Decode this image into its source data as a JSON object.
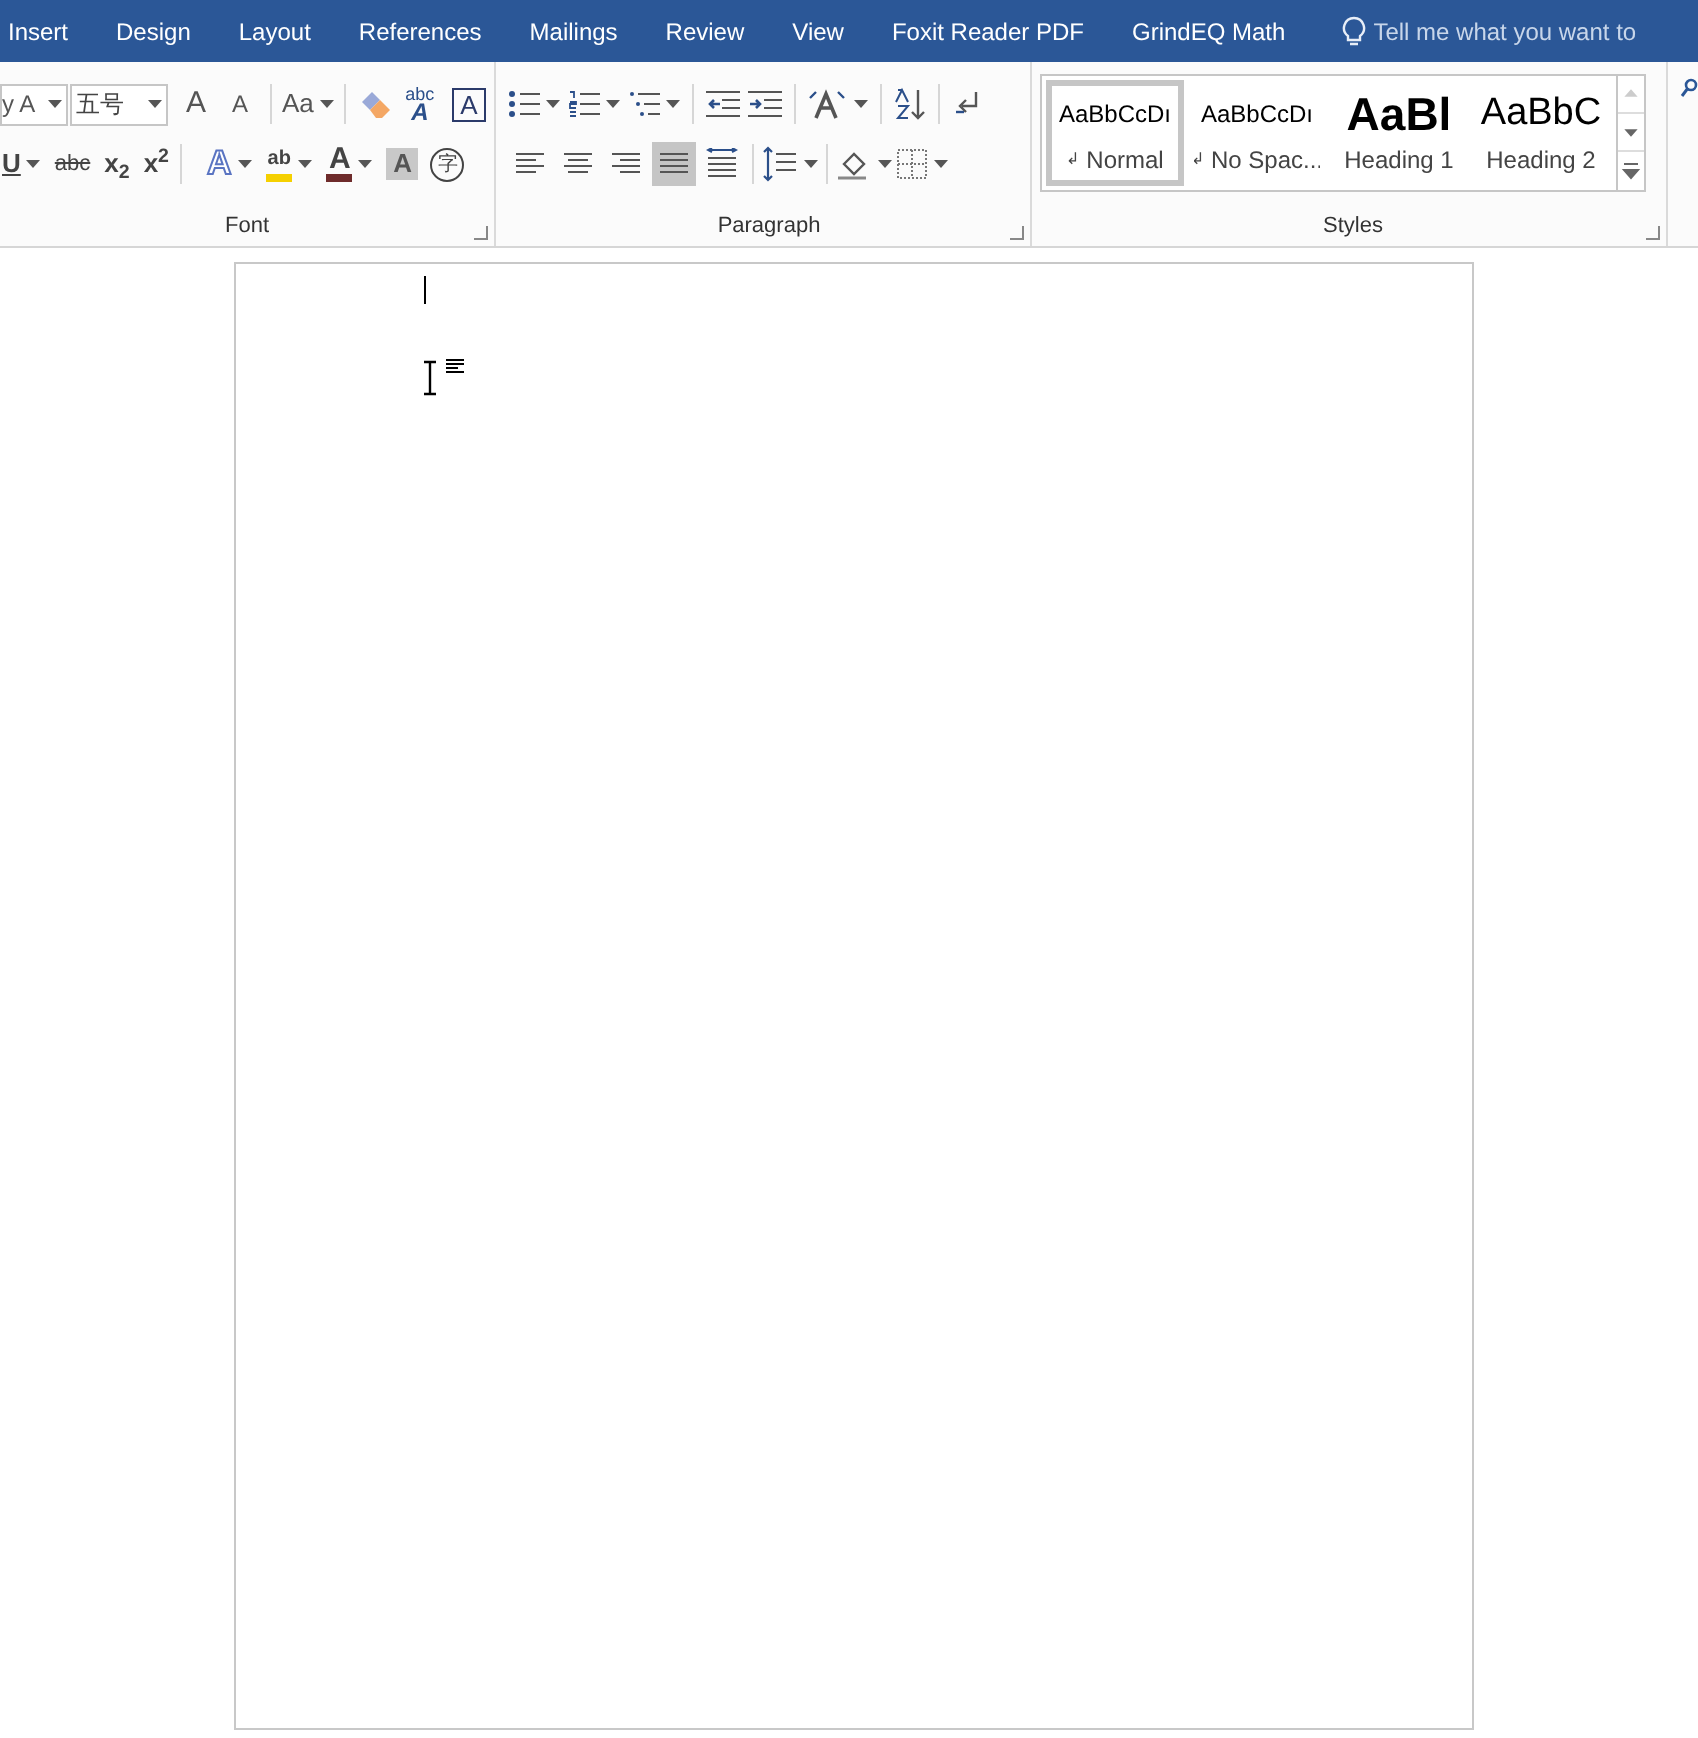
{
  "tabs": [
    {
      "label": "Insert"
    },
    {
      "label": "Design"
    },
    {
      "label": "Layout"
    },
    {
      "label": "References"
    },
    {
      "label": "Mailings"
    },
    {
      "label": "Review"
    },
    {
      "label": "View"
    },
    {
      "label": "Foxit Reader PDF"
    },
    {
      "label": "GrindEQ Math"
    }
  ],
  "tell_me": {
    "placeholder": "Tell me what you want to"
  },
  "font": {
    "label": "Font",
    "font_name": "y A",
    "font_size": "五号",
    "row1": [
      {
        "kind": "grow",
        "text": "A"
      },
      {
        "kind": "shrink",
        "text": "A"
      },
      {
        "kind": "sep"
      },
      {
        "kind": "case",
        "text": "Aa"
      },
      {
        "kind": "sep"
      },
      {
        "kind": "clear"
      },
      {
        "kind": "phonetic",
        "text": "abc",
        "sub": "A"
      },
      {
        "kind": "boxed",
        "text": "A"
      }
    ],
    "row2": [
      {
        "kind": "underline",
        "text": "U"
      },
      {
        "kind": "strike",
        "text": "abc"
      },
      {
        "kind": "script",
        "text": "x$_{2}$"
      },
      {
        "kind": "script",
        "text": "x$^{2}$"
      },
      {
        "kind": "sep"
      },
      {
        "kind": "effects",
        "text": "A"
      },
      {
        "kind": "highlight",
        "text": "ab",
        "color": "#f5d000"
      },
      {
        "kind": "fontcolor",
        "text": "A",
        "color": "#6e2b2b"
      },
      {
        "kind": "shaded",
        "text": "A"
      },
      {
        "kind": "enclosed",
        "text": "字"
      }
    ]
  },
  "paragraph": {
    "label": "Paragraph",
    "row1": [
      {
        "kind": "bullets"
      },
      {
        "kind": "numbering"
      },
      {
        "kind": "multilevel"
      },
      {
        "kind": "sep"
      },
      {
        "kind": "outdent"
      },
      {
        "kind": "indent"
      },
      {
        "kind": "sep"
      },
      {
        "kind": "asian"
      },
      {
        "kind": "sep"
      },
      {
        "kind": "sort"
      },
      {
        "kind": "sep"
      },
      {
        "kind": "marks"
      }
    ],
    "row2": [
      {
        "kind": "left",
        "selected": false
      },
      {
        "kind": "center",
        "selected": false
      },
      {
        "kind": "right",
        "selected": false
      },
      {
        "kind": "justify",
        "selected": true
      },
      {
        "kind": "distributed",
        "selected": false
      },
      {
        "kind": "sep"
      },
      {
        "kind": "spacing"
      },
      {
        "kind": "sep"
      },
      {
        "kind": "shading"
      },
      {
        "kind": "borders"
      }
    ]
  },
  "styles": {
    "label": "Styles",
    "items": [
      {
        "kind": "body",
        "sample": "AaBbCcDı",
        "mark": "↲",
        "name": "Normal",
        "selected": true
      },
      {
        "kind": "body",
        "sample": "AaBbCcDı",
        "mark": "↲",
        "name": "No Spac...",
        "selected": false
      },
      {
        "kind": "heading1",
        "sample": "AaBl",
        "name": "Heading 1",
        "selected": false
      },
      {
        "kind": "heading2",
        "sample": "AaBbC",
        "name": "Heading 2",
        "selected": false
      }
    ]
  }
}
